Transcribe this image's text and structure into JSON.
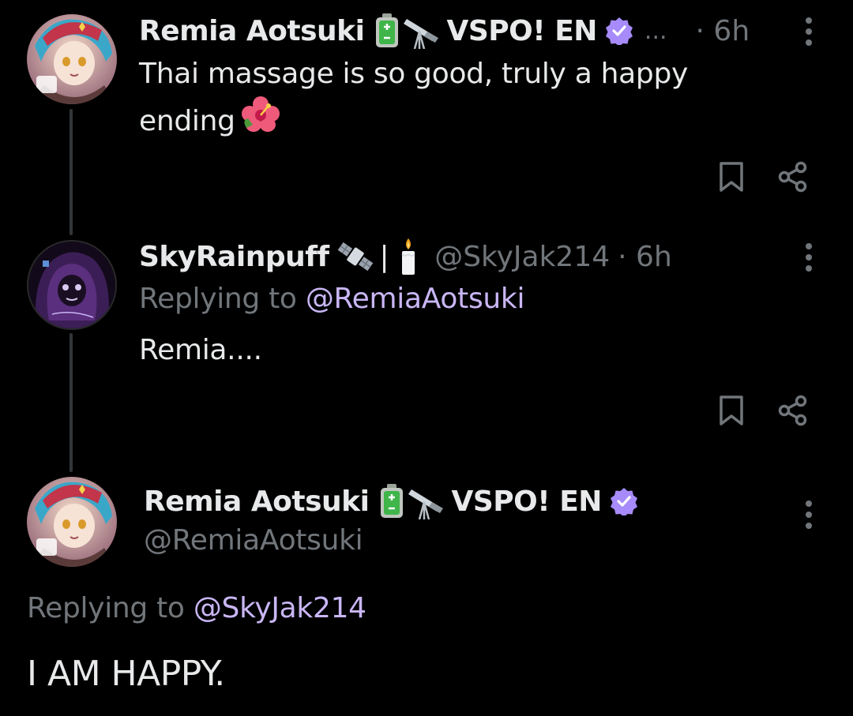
{
  "colors": {
    "background": "#000000",
    "text_primary": "#e7e9ea",
    "text_muted": "#71767b",
    "mention": "#c9b6f5",
    "verified_badge": "#a78bfa",
    "thread_line": "#333639"
  },
  "tweets": [
    {
      "display_name": "Remia Aotsuki",
      "name_emojis": [
        "battery-icon",
        "telescope-icon"
      ],
      "org": "VSPO! EN",
      "verified": true,
      "truncation": "...",
      "time": "· 6h",
      "text_line1": "Thai massage is so good, truly a happy",
      "text_line2": "ending",
      "text_emoji": "hibiscus-icon",
      "actions": [
        "bookmark-icon",
        "share-icon"
      ]
    },
    {
      "display_name": "SkyRainpuff",
      "name_emojis": [
        "satellite-icon",
        "candle-icon"
      ],
      "separator": "|",
      "handle": "@SkyJak214",
      "time": "· 6h",
      "replying_prefix": "Replying to",
      "replying_to": "@RemiaAotsuki",
      "text": "Remia....",
      "actions": [
        "bookmark-icon",
        "share-icon"
      ]
    },
    {
      "display_name": "Remia Aotsuki",
      "name_emojis": [
        "battery-icon",
        "telescope-icon"
      ],
      "org": "VSPO! EN",
      "verified": true,
      "handle": "@RemiaAotsuki",
      "replying_prefix": "Replying to",
      "replying_to": "@SkyJak214",
      "text": "I AM HAPPY."
    }
  ]
}
